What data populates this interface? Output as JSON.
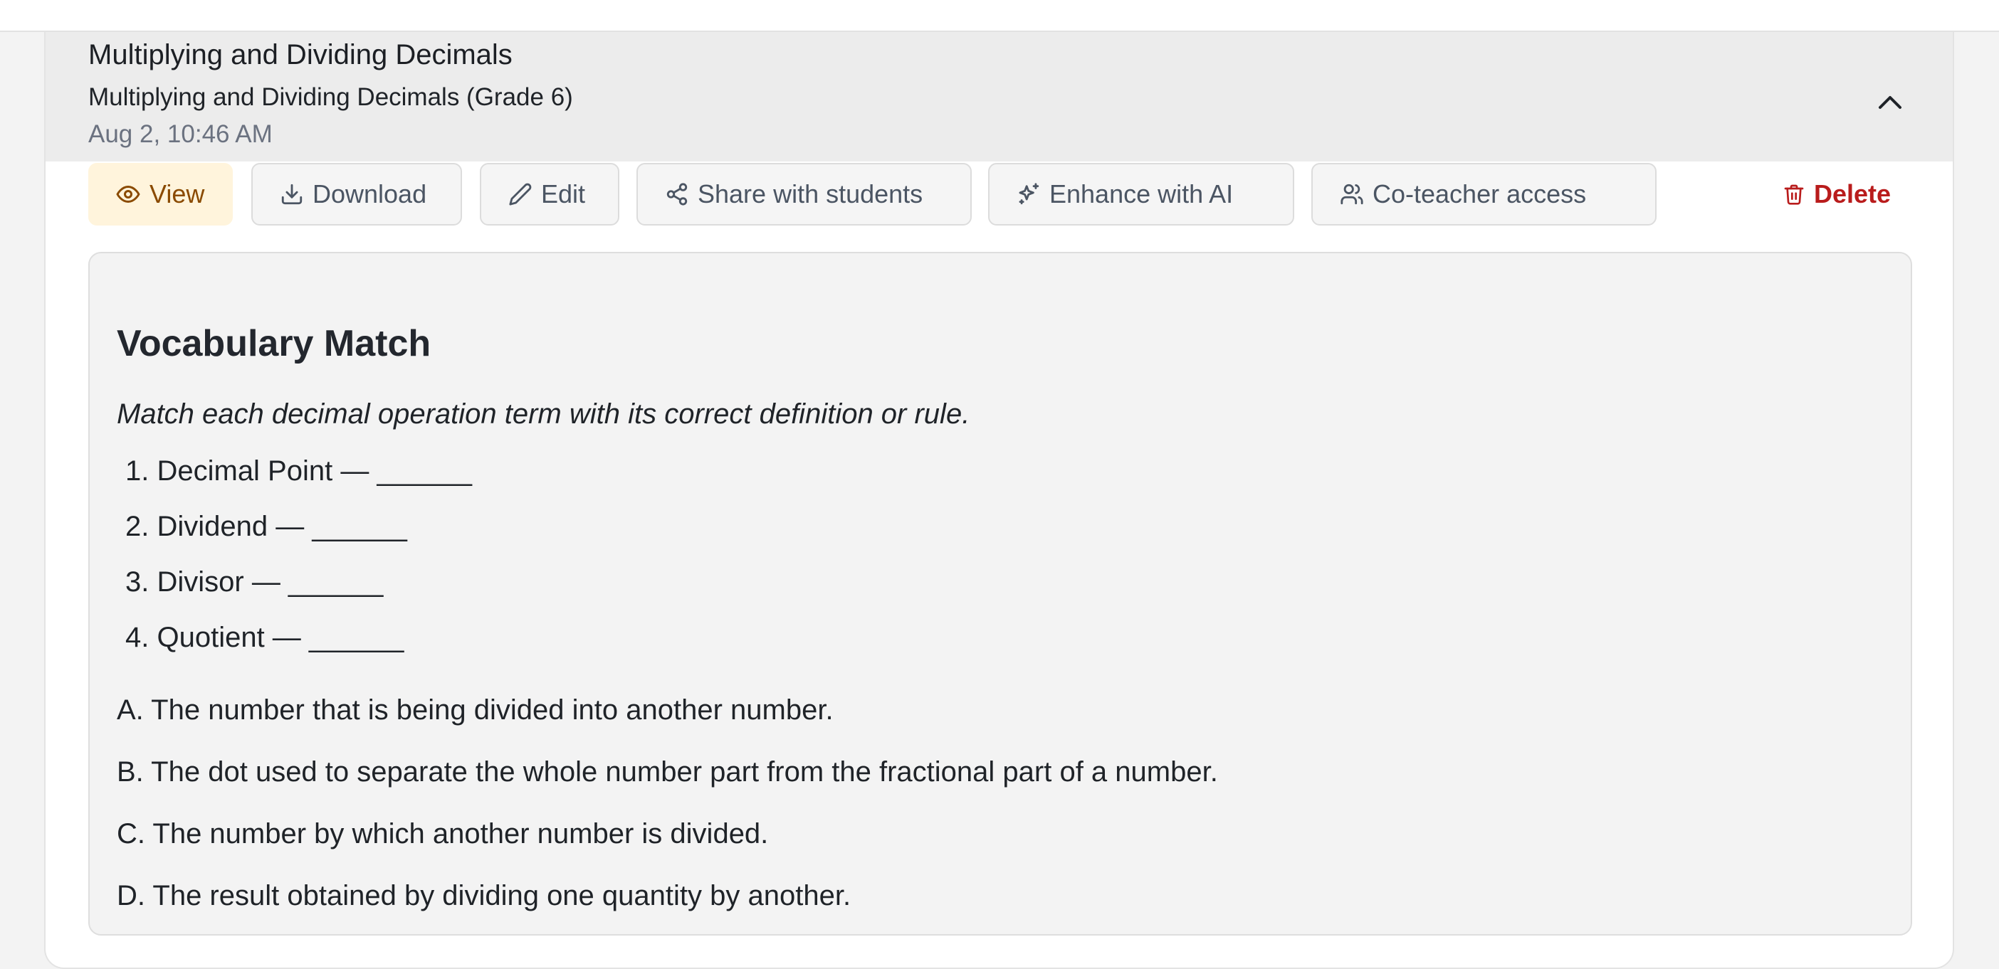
{
  "header": {
    "title": "Multiplying and Dividing Decimals",
    "subtitle": "Multiplying and Dividing Decimals (Grade 6)",
    "date": "Aug 2, 10:46 AM",
    "collapse_icon": "chevron-up-icon"
  },
  "toolbar": {
    "view": {
      "label": "View",
      "icon": "eye-icon"
    },
    "download": {
      "label": "Download",
      "icon": "download-icon"
    },
    "edit": {
      "label": "Edit",
      "icon": "pencil-icon"
    },
    "share": {
      "label": "Share with students",
      "icon": "share-icon"
    },
    "enhance": {
      "label": "Enhance with AI",
      "icon": "sparkles-icon"
    },
    "coteacher": {
      "label": "Co-teacher access",
      "icon": "users-icon"
    },
    "delete": {
      "label": "Delete",
      "icon": "trash-icon"
    }
  },
  "content": {
    "title": "Vocabulary Match",
    "instructions": "Match each decimal operation term with its correct definition or rule.",
    "terms": [
      "1. Decimal Point — ______",
      "2. Dividend — ______",
      "3. Divisor — ______",
      "4. Quotient — ______"
    ],
    "definitions": [
      "A. The number that is being divided into another number.",
      "B. The dot used to separate the whole number part from the fractional part of a number.",
      "C. The number by which another number is divided.",
      "D. The result obtained by dividing one quantity by another."
    ]
  },
  "colors": {
    "view_bg": "#fff4dc",
    "view_text": "#8a4a00",
    "delete_text": "#b91c1c",
    "header_bg": "#ececec"
  }
}
